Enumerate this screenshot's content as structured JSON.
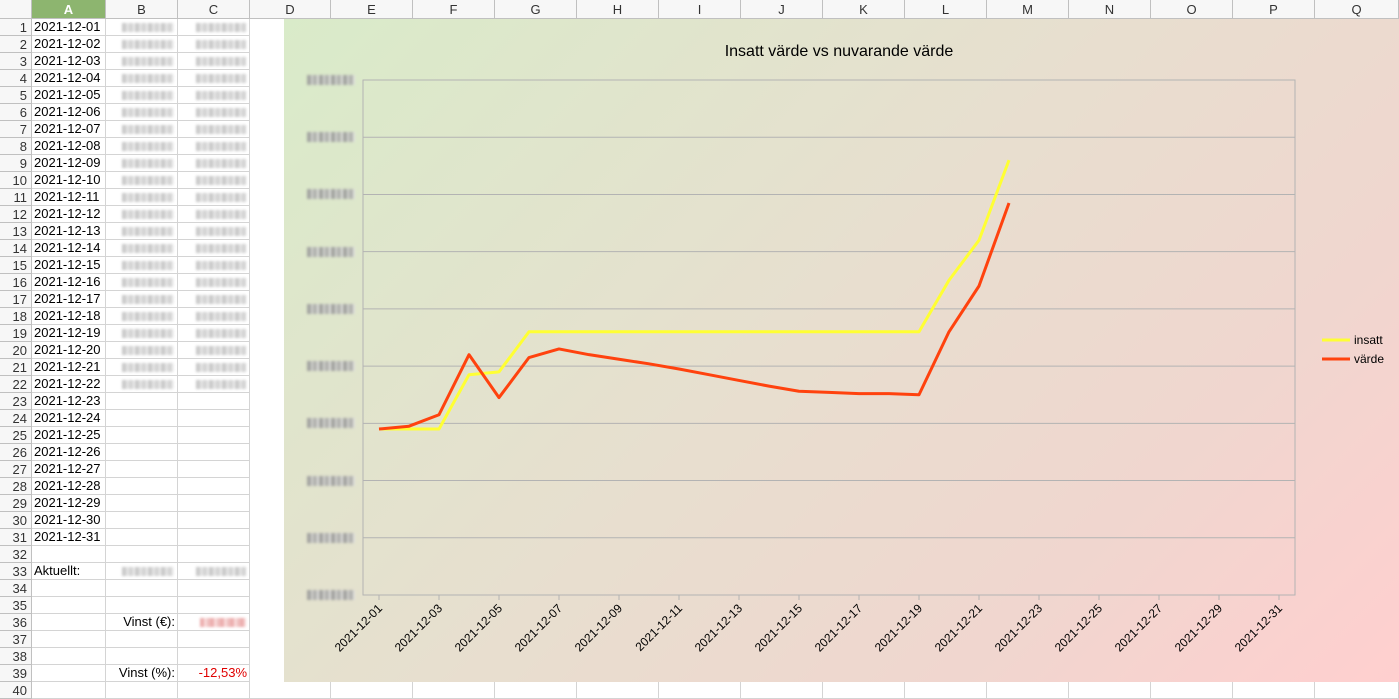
{
  "spreadsheet": {
    "columns": [
      "A",
      "B",
      "C",
      "D",
      "E",
      "F",
      "G",
      "H",
      "I",
      "J",
      "K",
      "L",
      "M",
      "N",
      "O",
      "P",
      "Q"
    ],
    "selected_column": "A",
    "rows": [
      "1",
      "2",
      "3",
      "4",
      "5",
      "6",
      "7",
      "8",
      "9",
      "10",
      "11",
      "12",
      "13",
      "14",
      "15",
      "16",
      "17",
      "18",
      "19",
      "20",
      "21",
      "22",
      "23",
      "24",
      "25",
      "26",
      "27",
      "28",
      "29",
      "30",
      "31",
      "32",
      "33",
      "34",
      "35",
      "36",
      "37",
      "38",
      "39",
      "40"
    ],
    "dates": [
      "2021-12-01",
      "2021-12-02",
      "2021-12-03",
      "2021-12-04",
      "2021-12-05",
      "2021-12-06",
      "2021-12-07",
      "2021-12-08",
      "2021-12-09",
      "2021-12-10",
      "2021-12-11",
      "2021-12-12",
      "2021-12-13",
      "2021-12-14",
      "2021-12-15",
      "2021-12-16",
      "2021-12-17",
      "2021-12-18",
      "2021-12-19",
      "2021-12-20",
      "2021-12-21",
      "2021-12-22",
      "2021-12-23",
      "2021-12-24",
      "2021-12-25",
      "2021-12-26",
      "2021-12-27",
      "2021-12-28",
      "2021-12-29",
      "2021-12-30",
      "2021-12-31"
    ],
    "aktuellt_label": "Aktuellt:",
    "vinst_eur_label": "Vinst (€):",
    "vinst_pct_label": "Vinst (%):",
    "vinst_pct_value": "-12,53%",
    "negative_color": "#e00000"
  },
  "chart_data": {
    "type": "line",
    "title": "Insatt värde vs nuvarande värde",
    "x_tick_labels": [
      "2021-12-01",
      "2021-12-03",
      "2021-12-05",
      "2021-12-07",
      "2021-12-09",
      "2021-12-11",
      "2021-12-13",
      "2021-12-15",
      "2021-12-17",
      "2021-12-19",
      "2021-12-21",
      "2021-12-23",
      "2021-12-25",
      "2021-12-27",
      "2021-12-29",
      "2021-12-31"
    ],
    "x": [
      "2021-12-01",
      "2021-12-02",
      "2021-12-03",
      "2021-12-04",
      "2021-12-05",
      "2021-12-06",
      "2021-12-07",
      "2021-12-08",
      "2021-12-09",
      "2021-12-10",
      "2021-12-11",
      "2021-12-12",
      "2021-12-13",
      "2021-12-14",
      "2021-12-15",
      "2021-12-16",
      "2021-12-17",
      "2021-12-18",
      "2021-12-19",
      "2021-12-20",
      "2021-12-21",
      "2021-12-22"
    ],
    "xlim": [
      "2021-12-01",
      "2021-12-31"
    ],
    "ylim": [
      0,
      9
    ],
    "y_tick_count": 10,
    "y_tick_labels_obscured": true,
    "series": [
      {
        "name": "insatt",
        "color": "#ffff33",
        "values": [
          2.9,
          2.9,
          2.9,
          3.85,
          3.9,
          4.6,
          4.6,
          4.6,
          4.6,
          4.6,
          4.6,
          4.6,
          4.6,
          4.6,
          4.6,
          4.6,
          4.6,
          4.6,
          4.6,
          5.5,
          6.2,
          7.6
        ]
      },
      {
        "name": "värde",
        "color": "#ff420e",
        "values": [
          2.9,
          2.95,
          3.15,
          4.2,
          3.45,
          4.15,
          4.3,
          4.2,
          4.12,
          4.04,
          3.95,
          3.85,
          3.75,
          3.65,
          3.56,
          3.54,
          3.52,
          3.52,
          3.5,
          4.6,
          5.4,
          6.85
        ]
      }
    ],
    "legend_position": "right",
    "grid": true
  }
}
